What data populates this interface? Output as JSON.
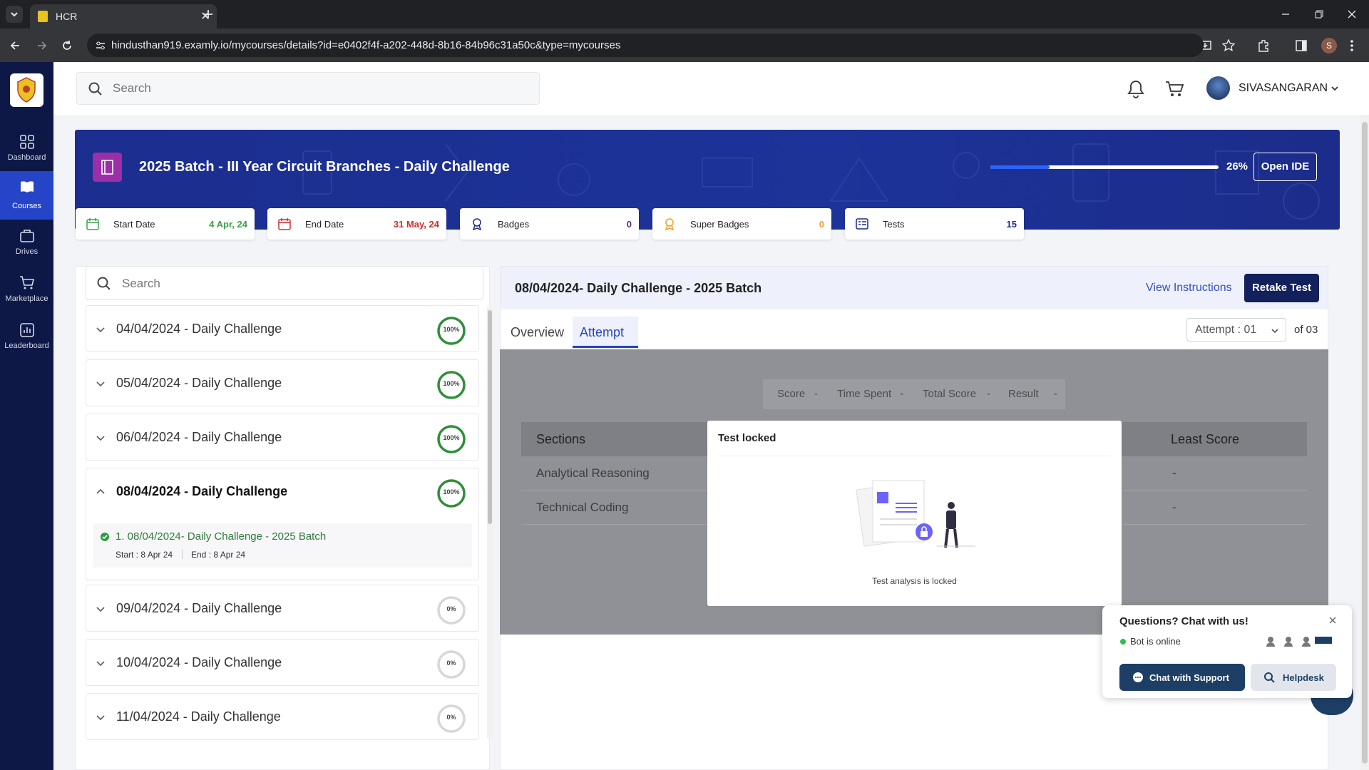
{
  "browser": {
    "tab_title": "HCR",
    "url": "hindusthan919.examly.io/mycourses/details?id=e0402f4f-a202-448d-8b16-84b96c31a50c&type=mycourses",
    "profile_initial": "S"
  },
  "sidebar": {
    "items": [
      {
        "label": "Dashboard",
        "icon": "grid-icon"
      },
      {
        "label": "Courses",
        "icon": "book-icon",
        "active": true
      },
      {
        "label": "Drives",
        "icon": "briefcase-icon"
      },
      {
        "label": "Marketplace",
        "icon": "cart-icon"
      },
      {
        "label": "Leaderboard",
        "icon": "chart-icon"
      }
    ]
  },
  "topbar": {
    "search_placeholder": "Search",
    "user_name": "SIVASANGARAN"
  },
  "course": {
    "title": "2025 Batch - III Year Circuit Branches - Daily Challenge",
    "progress_label": "26%",
    "progress": 0.26,
    "open_ide_label": "Open IDE",
    "stats": [
      {
        "label": "Start Date",
        "value": "4 Apr, 24",
        "color": "#3aa34a"
      },
      {
        "label": "End Date",
        "value": "31 May, 24",
        "color": "#d22b2b"
      },
      {
        "label": "Badges",
        "value": "0",
        "color": "#5a2a82"
      },
      {
        "label": "Super Badges",
        "value": "0",
        "color": "#f0a030"
      },
      {
        "label": "Tests",
        "value": "15",
        "color": "#1c2c8a"
      }
    ]
  },
  "list": {
    "search_placeholder": "Search",
    "modules": [
      {
        "title": "04/04/2024 - Daily Challenge",
        "pct": "100%",
        "progress": 1
      },
      {
        "title": "05/04/2024 - Daily Challenge",
        "pct": "100%",
        "progress": 1
      },
      {
        "title": "06/04/2024 - Daily Challenge",
        "pct": "100%",
        "progress": 1
      },
      {
        "title": "08/04/2024 - Daily Challenge",
        "pct": "100%",
        "progress": 1
      },
      {
        "title": "09/04/2024 - Daily Challenge",
        "pct": "0%",
        "progress": 0
      },
      {
        "title": "10/04/2024 - Daily Challenge",
        "pct": "0%",
        "progress": 0
      },
      {
        "title": "11/04/2024 - Daily Challenge",
        "pct": "0%",
        "progress": 0
      }
    ],
    "expanded_item": {
      "title": "1. 08/04/2024- Daily Challenge - 2025 Batch",
      "start": "Start : 8 Apr 24",
      "end": "End : 8 Apr 24"
    }
  },
  "test": {
    "title": "08/04/2024- Daily Challenge - 2025 Batch",
    "view_instructions": "View Instructions",
    "retake_label": "Retake Test",
    "tabs": [
      "Overview",
      "Attempt"
    ],
    "attempt_select": "Attempt : 01",
    "attempt_of": "of 03",
    "summary": [
      "Score",
      "-",
      "Time Spent",
      "-",
      "Total Score",
      "-",
      "Result",
      "-"
    ],
    "table_headers": [
      "Sections",
      "Least Score"
    ],
    "rows": [
      {
        "section": "Analytical Reasoning",
        "least": "-"
      },
      {
        "section": "Technical Coding",
        "least": "-"
      }
    ],
    "locked_title": "Test locked",
    "locked_message": "Test analysis is locked"
  },
  "chat": {
    "title": "Questions? Chat with us!",
    "status": "Bot is online",
    "chat_button": "Chat with Support",
    "helpdesk_button": "Helpdesk"
  }
}
